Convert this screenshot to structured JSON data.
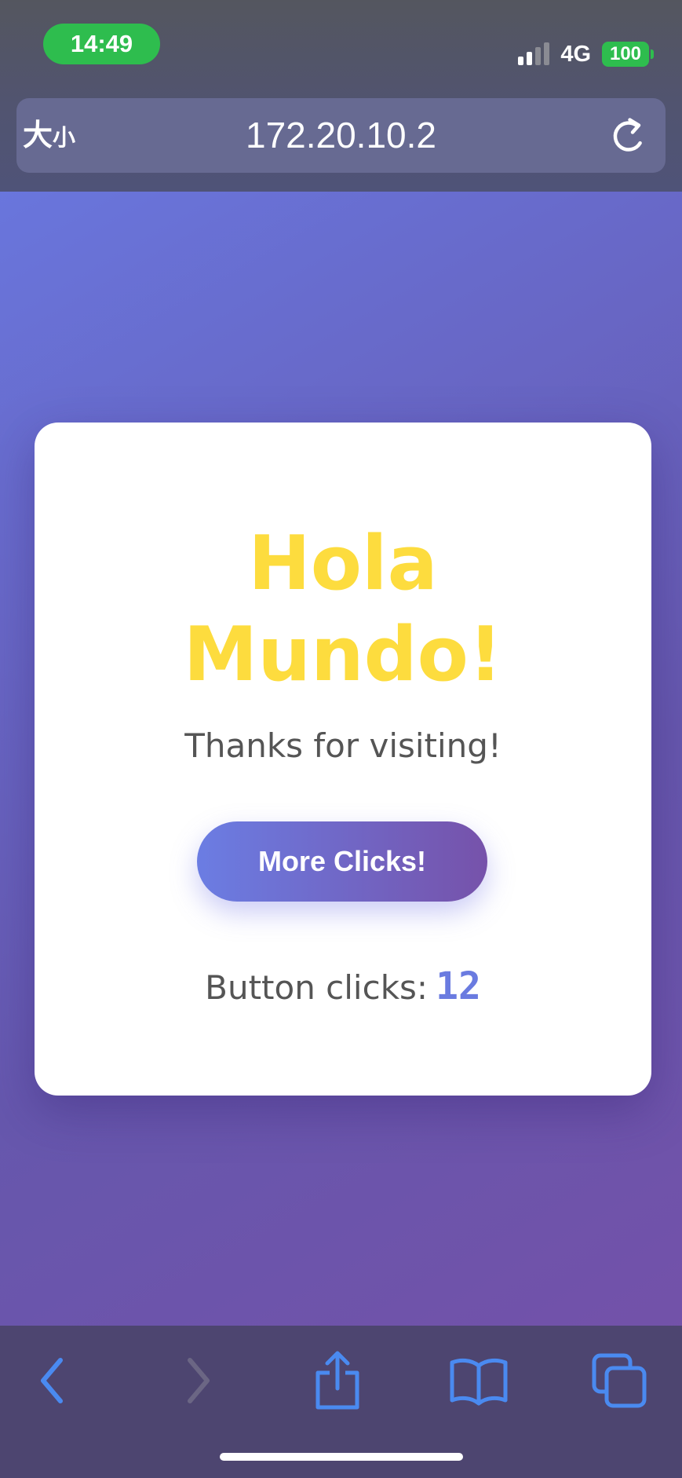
{
  "status_bar": {
    "time": "14:49",
    "network": "4G",
    "battery": "100"
  },
  "browser": {
    "text_size_large": "大",
    "text_size_small": "小",
    "url": "172.20.10.2",
    "icons": {
      "reload": "reload-icon",
      "back": "chevron-left-icon",
      "forward": "chevron-right-icon",
      "share": "share-icon",
      "bookmarks": "book-icon",
      "tabs": "tabs-icon"
    }
  },
  "page": {
    "title_line1": "Hola",
    "title_line2": "Mundo!",
    "subtitle": "Thanks for visiting!",
    "button_label": "More Clicks!",
    "counter_label": "Button clicks:",
    "counter_value": "12"
  },
  "colors": {
    "title": "#fddc3e",
    "accent": "#6a7be0",
    "toolbar_icon": "#4a8af0",
    "status_green": "#2ebd4e"
  }
}
